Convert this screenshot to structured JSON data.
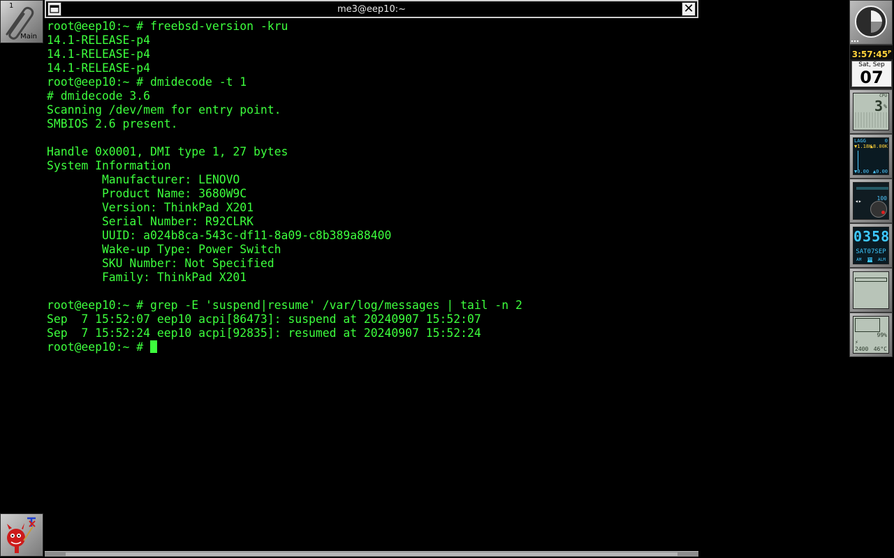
{
  "workspace": {
    "number": "1",
    "name": "Main"
  },
  "window": {
    "title": "me3@eep10:~"
  },
  "terminal": {
    "lines": [
      "root@eep10:~ # freebsd-version -kru",
      "14.1-RELEASE-p4",
      "14.1-RELEASE-p4",
      "14.1-RELEASE-p4",
      "root@eep10:~ # dmidecode -t 1",
      "# dmidecode 3.6",
      "Scanning /dev/mem for entry point.",
      "SMBIOS 2.6 present.",
      "",
      "Handle 0x0001, DMI type 1, 27 bytes",
      "System Information",
      "        Manufacturer: LENOVO",
      "        Product Name: 3680W9C",
      "        Version: ThinkPad X201",
      "        Serial Number: R92CLRK",
      "        UUID: a024b8ca-543c-df11-8a09-c8b389a88400",
      "        Wake-up Type: Power Switch",
      "        SKU Number: Not Specified",
      "        Family: ThinkPad X201",
      "",
      "root@eep10:~ # grep -E 'suspend|resume' /var/log/messages | tail -n 2",
      "Sep  7 15:52:07 eep10 acpi[86473]: suspend at 20240907 15:52:07",
      "Sep  7 15:52:24 eep10 acpi[92835]: resumed at 20240907 15:52:24"
    ],
    "prompt": "root@eep10:~ # "
  },
  "dock": {
    "clock_time": "3:57:45",
    "clock_ampm": "P",
    "date_dow": "Sat, Sep",
    "date_day": "07",
    "cpu_label": "CPU",
    "cpu_value": "3",
    "cpu_unit": "%",
    "net_iface": "LAGG",
    "net_number": "0",
    "net_rx": "1.18K",
    "net_tx": "8.00K",
    "net_rx2": "0.00",
    "net_tx2": "0.00",
    "mixer_value": "100",
    "lcd_clock_time": "0358",
    "lcd_clock_date": "SAT07SEP",
    "lcd_clock_flags": [
      "AM",
      "PM",
      "ALM"
    ],
    "battery_percent": "99",
    "battery_temp": "46°C",
    "battery_time": "2400"
  },
  "colors": {
    "terminal_fg": "#3dff3d",
    "background": "#000000"
  }
}
